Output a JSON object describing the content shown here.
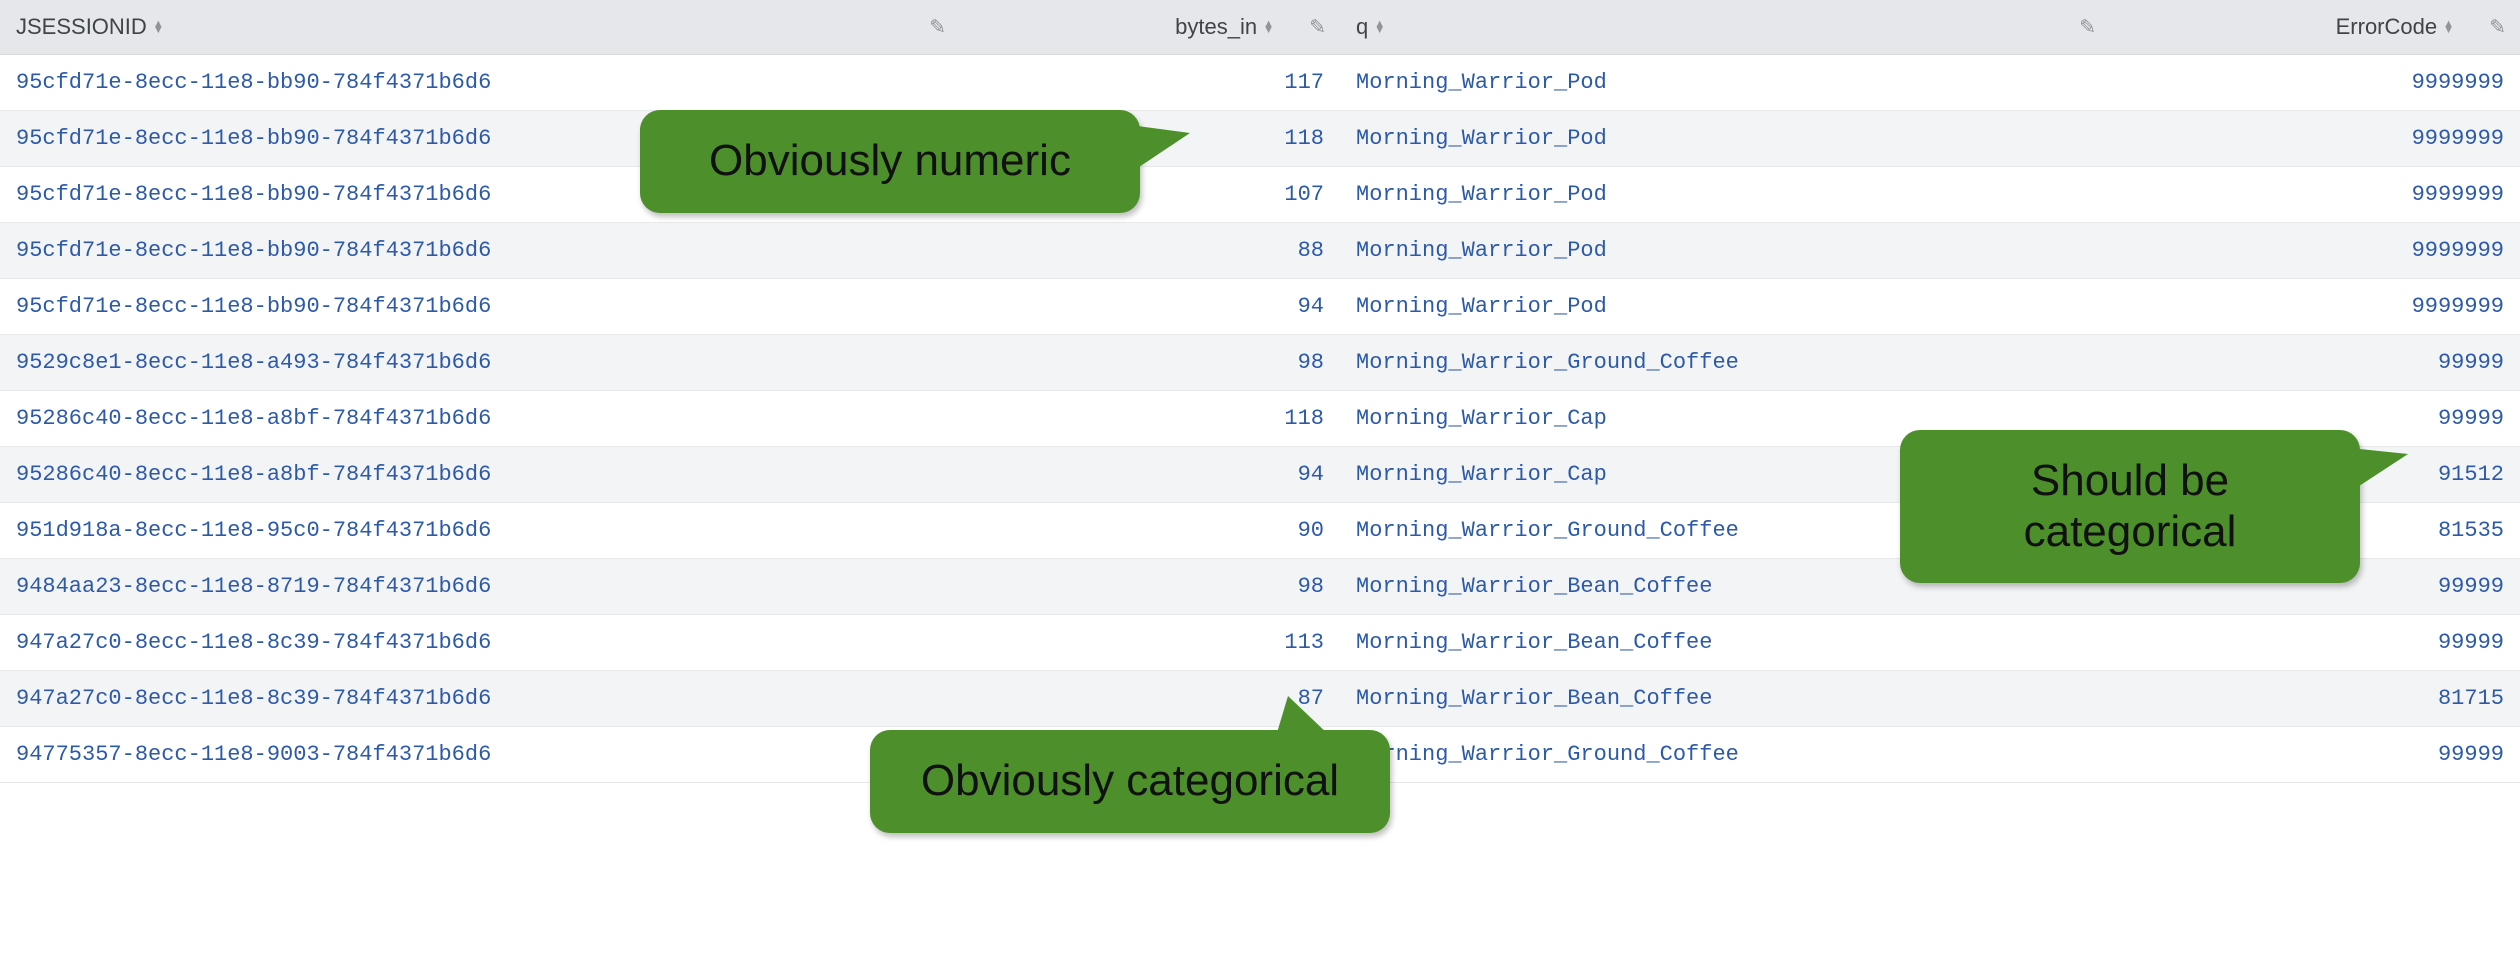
{
  "columns": {
    "jsessionid": "JSESSIONID",
    "bytes_in": "bytes_in",
    "q": "q",
    "error_code": "ErrorCode"
  },
  "rows": [
    {
      "jsessionid": "95cfd71e-8ecc-11e8-bb90-784f4371b6d6",
      "bytes_in": "117",
      "q": "Morning_Warrior_Pod",
      "error_code": "9999999"
    },
    {
      "jsessionid": "95cfd71e-8ecc-11e8-bb90-784f4371b6d6",
      "bytes_in": "118",
      "q": "Morning_Warrior_Pod",
      "error_code": "9999999"
    },
    {
      "jsessionid": "95cfd71e-8ecc-11e8-bb90-784f4371b6d6",
      "bytes_in": "107",
      "q": "Morning_Warrior_Pod",
      "error_code": "9999999"
    },
    {
      "jsessionid": "95cfd71e-8ecc-11e8-bb90-784f4371b6d6",
      "bytes_in": "88",
      "q": "Morning_Warrior_Pod",
      "error_code": "9999999"
    },
    {
      "jsessionid": "95cfd71e-8ecc-11e8-bb90-784f4371b6d6",
      "bytes_in": "94",
      "q": "Morning_Warrior_Pod",
      "error_code": "9999999"
    },
    {
      "jsessionid": "9529c8e1-8ecc-11e8-a493-784f4371b6d6",
      "bytes_in": "98",
      "q": "Morning_Warrior_Ground_Coffee",
      "error_code": "99999"
    },
    {
      "jsessionid": "95286c40-8ecc-11e8-a8bf-784f4371b6d6",
      "bytes_in": "118",
      "q": "Morning_Warrior_Cap",
      "error_code": "99999"
    },
    {
      "jsessionid": "95286c40-8ecc-11e8-a8bf-784f4371b6d6",
      "bytes_in": "94",
      "q": "Morning_Warrior_Cap",
      "error_code": "91512"
    },
    {
      "jsessionid": "951d918a-8ecc-11e8-95c0-784f4371b6d6",
      "bytes_in": "90",
      "q": "Morning_Warrior_Ground_Coffee",
      "error_code": "81535"
    },
    {
      "jsessionid": "9484aa23-8ecc-11e8-8719-784f4371b6d6",
      "bytes_in": "98",
      "q": "Morning_Warrior_Bean_Coffee",
      "error_code": "99999"
    },
    {
      "jsessionid": "947a27c0-8ecc-11e8-8c39-784f4371b6d6",
      "bytes_in": "113",
      "q": "Morning_Warrior_Bean_Coffee",
      "error_code": "99999"
    },
    {
      "jsessionid": "947a27c0-8ecc-11e8-8c39-784f4371b6d6",
      "bytes_in": "87",
      "q": "Morning_Warrior_Bean_Coffee",
      "error_code": "81715"
    },
    {
      "jsessionid": "94775357-8ecc-11e8-9003-784f4371b6d6",
      "bytes_in": "",
      "q": "Morning_Warrior_Ground_Coffee",
      "error_code": "99999"
    }
  ],
  "callouts": {
    "numeric": "Obviously numeric",
    "q": "Obviously categorical",
    "error": "Should be categorical"
  }
}
